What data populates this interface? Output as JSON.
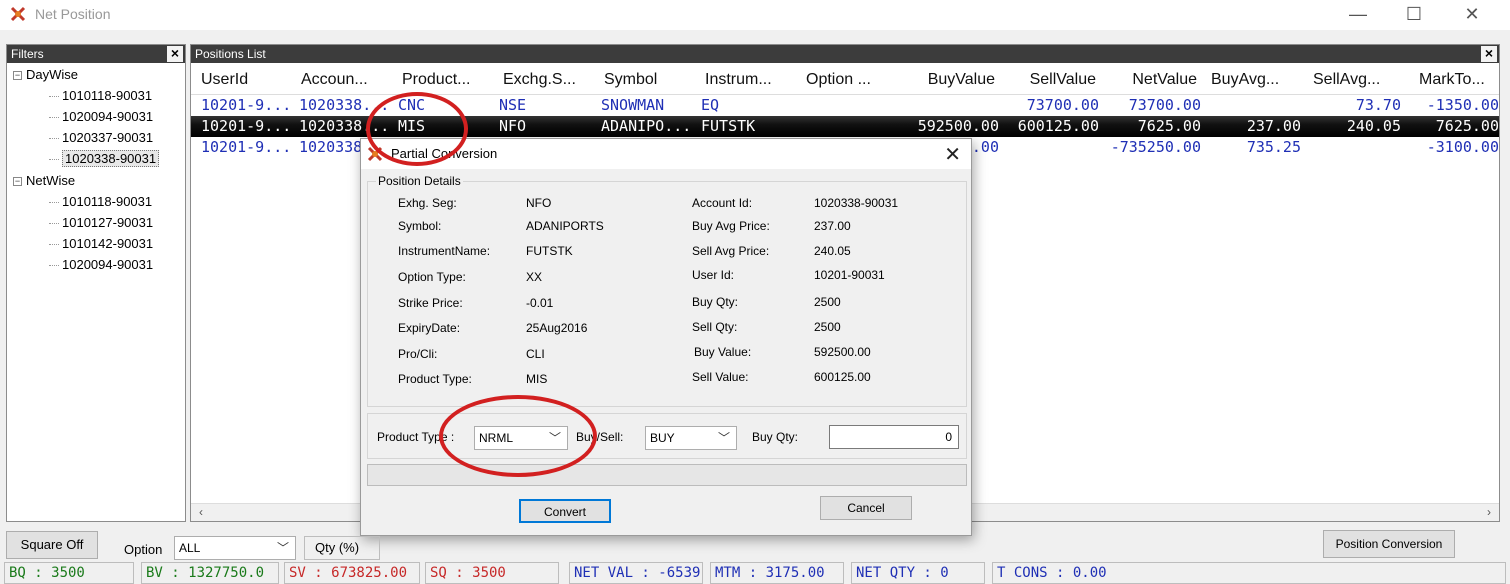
{
  "window": {
    "title": "Net Position",
    "minimize": "—",
    "maximize": "☐",
    "close": "✕"
  },
  "filters": {
    "header": "Filters",
    "daywise": {
      "label": "DayWise",
      "items": [
        "1010118-90031",
        "1020094-90031",
        "1020337-90031",
        "1020338-90031"
      ]
    },
    "netwise": {
      "label": "NetWise",
      "items": [
        "1010118-90031",
        "1010127-90031",
        "1010142-90031",
        "1020094-90031"
      ]
    }
  },
  "positions": {
    "header": "Positions List",
    "columns": [
      "UserId",
      "Accoun...",
      "Product...",
      "Exchg.S...",
      "Symbol",
      "Instrum...",
      "Option ...",
      "BuyValue",
      "SellValue",
      "NetValue",
      "BuyAvg...",
      "SellAvg...",
      "MarkTo..."
    ],
    "rows": [
      [
        "10201-9...",
        "1020338...",
        "CNC",
        "NSE",
        "SNOWMAN",
        "EQ",
        "",
        "",
        "73700.00",
        "73700.00",
        "",
        "73.70",
        "-1350.00"
      ],
      [
        "10201-9...",
        "1020338...",
        "MIS",
        "NFO",
        "ADANIPO...",
        "FUTSTK",
        "",
        "592500.00",
        "600125.00",
        "7625.00",
        "237.00",
        "240.05",
        "7625.00"
      ],
      [
        "10201-9...",
        "1020338...",
        "",
        "",
        "",
        "",
        "",
        ".00",
        "",
        "-735250.00",
        "735.25",
        "",
        "-3100.00"
      ]
    ]
  },
  "dialog": {
    "title": "Partial Conversion",
    "group": "Position Details",
    "left": [
      {
        "label": "Exhg. Seg:",
        "value": "NFO"
      },
      {
        "label": "Symbol:",
        "value": "ADANIPORTS"
      },
      {
        "label": "InstrumentName:",
        "value": "FUTSTK"
      },
      {
        "label": "Option Type:",
        "value": "XX"
      },
      {
        "label": "Strike Price:",
        "value": "-0.01"
      },
      {
        "label": "ExpiryDate:",
        "value": "25Aug2016"
      },
      {
        "label": "Pro/Cli:",
        "value": "CLI"
      },
      {
        "label": "Product Type:",
        "value": "MIS"
      }
    ],
    "right": [
      {
        "label": "Account Id:",
        "value": "1020338-90031"
      },
      {
        "label": "Buy Avg Price:",
        "value": "237.00"
      },
      {
        "label": "Sell Avg Price:",
        "value": "240.05"
      },
      {
        "label": "User Id:",
        "value": "10201-90031"
      },
      {
        "label": "Buy Qty:",
        "value": "2500"
      },
      {
        "label": "Sell  Qty:",
        "value": "2500"
      },
      {
        "label": "Buy Value:",
        "value": "592500.00"
      },
      {
        "label": "Sell  Value:",
        "value": "600125.00"
      }
    ],
    "product_type_label": "Product Type :",
    "product_type_value": "NRML",
    "buysell_label": "Buy/Sell:",
    "buysell_value": "BUY",
    "buyqty_label": "Buy Qty:",
    "buyqty_value": "0",
    "convert": "Convert",
    "cancel": "Cancel"
  },
  "bottom": {
    "square_off": "Square Off",
    "option_label": "Option",
    "option_value": "ALL",
    "qty_label": "Qty (%)",
    "position_conversion": "Position Conversion"
  },
  "status": {
    "bq": "BQ : 3500",
    "bv": "BV : 1327750.0",
    "sv": "SV : 673825.00",
    "sq": "SQ : 3500",
    "net_val": "NET VAL : -6539",
    "mtm": "MTM : 3175.00",
    "net_qty": "NET QTY : 0",
    "t_cons": "T CONS : 0.00"
  },
  "colors": {
    "buy": "#1a7a1a",
    "sell": "#c62828",
    "neutral": "#1f2fb5",
    "highlight": "#d22020"
  }
}
